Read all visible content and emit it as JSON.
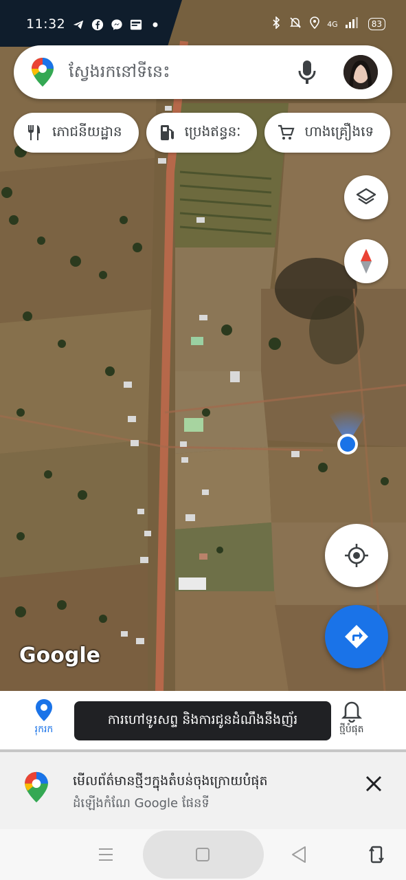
{
  "status_bar": {
    "time": "11:32",
    "network": "4G",
    "battery": "83",
    "icons": [
      "telegram-icon",
      "facebook-icon",
      "messenger-icon",
      "gallery-icon",
      "dot-icon",
      "bluetooth-icon",
      "mute-icon",
      "location-icon",
      "signal-icon"
    ]
  },
  "search": {
    "placeholder": "ស្វែងរកនៅទីនេះ",
    "icons": [
      "maps-pin-icon",
      "microphone-icon",
      "profile-avatar"
    ]
  },
  "chips": [
    {
      "label": "ភោជនីយដ្ឋាន",
      "icon": "restaurant-icon"
    },
    {
      "label": "ប្រេងឥន្ធនៈ",
      "icon": "gas-station-icon"
    },
    {
      "label": "ហាងគ្រឿងទេ",
      "icon": "cart-icon"
    }
  ],
  "map": {
    "attribution": "Google",
    "controls": [
      "layers-icon",
      "compass-icon",
      "my-location-icon",
      "directions-icon"
    ]
  },
  "bottom_nav": {
    "explore_label": "រុករក",
    "updates_label": "ថ្មីបំផុត"
  },
  "toast": {
    "text": "ការហៅទូរសព្ទ និងការជូនដំណឹងនឹងញ័រ"
  },
  "notification": {
    "title": "មើលព័ត៌មានថ្មីៗក្នុងតំបន់ចុងក្រោយបំផុត",
    "subtitle": "ដំឡើងកំណែ Google ផែនទី"
  },
  "colors": {
    "accent_blue": "#1a73e8",
    "location_dot": "#1a73e8",
    "map_ground": "#7a6445"
  }
}
